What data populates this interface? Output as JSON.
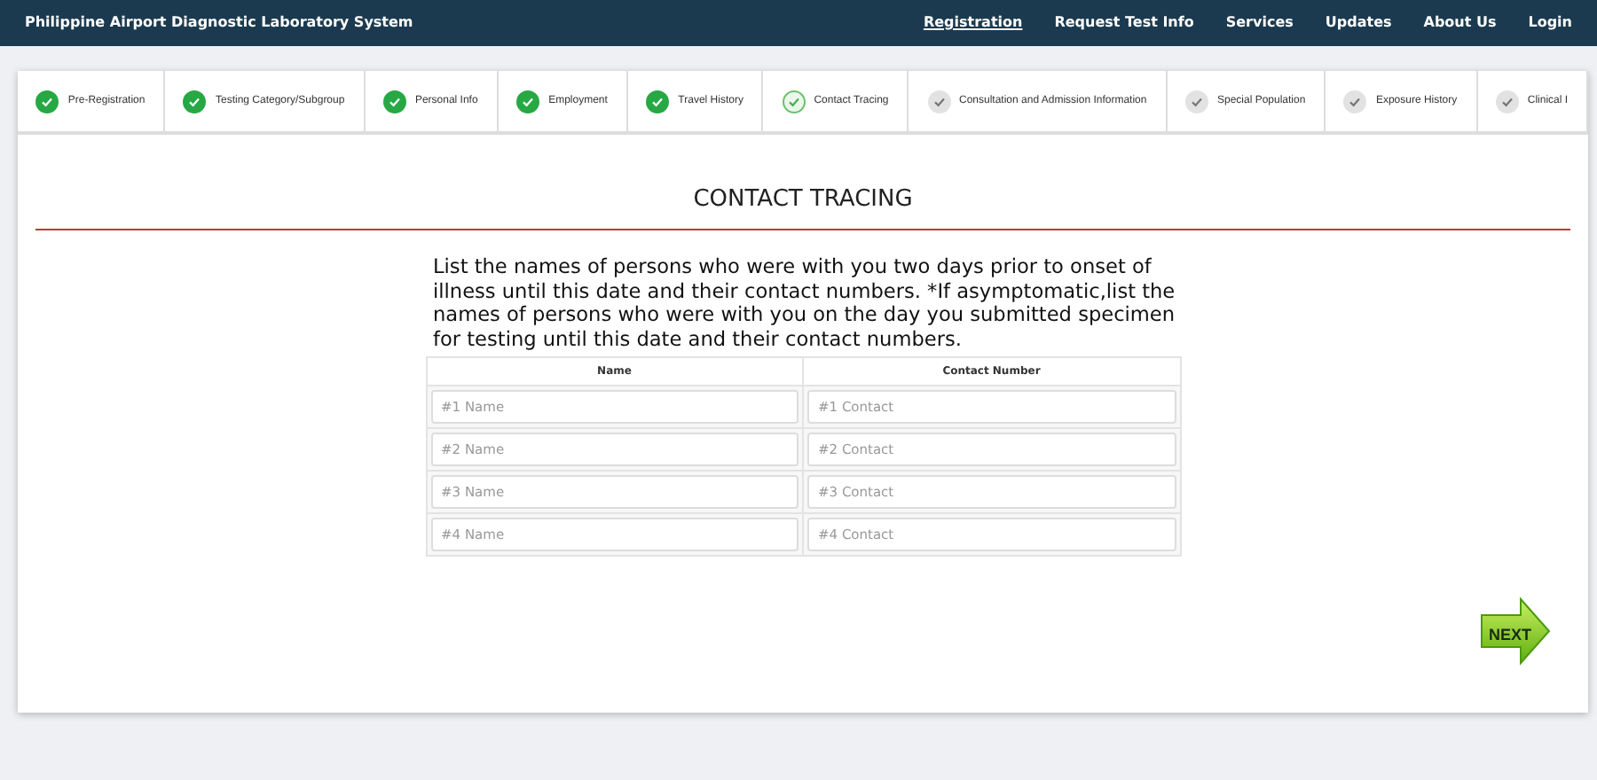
{
  "navbar": {
    "brand": "Philippine Airport Diagnostic Laboratory System",
    "links": [
      {
        "label": "Registration",
        "selected": true
      },
      {
        "label": "Request Test Info",
        "selected": false
      },
      {
        "label": "Services",
        "selected": false
      },
      {
        "label": "Updates",
        "selected": false
      },
      {
        "label": "About Us",
        "selected": false
      },
      {
        "label": "Login",
        "selected": false
      }
    ]
  },
  "steps": [
    {
      "label": "Pre-Registration",
      "completed": true,
      "selected": false
    },
    {
      "label": "Testing Category/Subgroup",
      "completed": true,
      "selected": false
    },
    {
      "label": "Personal Info",
      "completed": true,
      "selected": false
    },
    {
      "label": "Employment",
      "completed": true,
      "selected": false
    },
    {
      "label": "Travel History",
      "completed": true,
      "selected": false
    },
    {
      "label": "Contact Tracing",
      "completed": false,
      "selected": true
    },
    {
      "label": "Consultation and Admission Information",
      "completed": false,
      "selected": false
    },
    {
      "label": "Special Population",
      "completed": false,
      "selected": false
    },
    {
      "label": "Exposure History",
      "completed": false,
      "selected": false
    },
    {
      "label": "Clinical I",
      "completed": false,
      "selected": false
    }
  ],
  "section_title": "CONTACT TRACING",
  "instructions": "List the names of persons who were with you two days prior to onset of illness until this date and their contact numbers. *If asymptomatic,list the names of persons who were with you on the day you submitted specimen for testing until this date and their contact numbers.",
  "table": {
    "columns": [
      "Name",
      "Contact Number"
    ],
    "rows": [
      {
        "name_placeholder": "#1 Name",
        "contact_placeholder": "#1 Contact"
      },
      {
        "name_placeholder": "#2 Name",
        "contact_placeholder": "#2 Contact"
      },
      {
        "name_placeholder": "#3 Name",
        "contact_placeholder": "#3 Contact"
      },
      {
        "name_placeholder": "#4 Name",
        "contact_placeholder": "#4 Contact"
      }
    ]
  },
  "next_button": "NEXT"
}
